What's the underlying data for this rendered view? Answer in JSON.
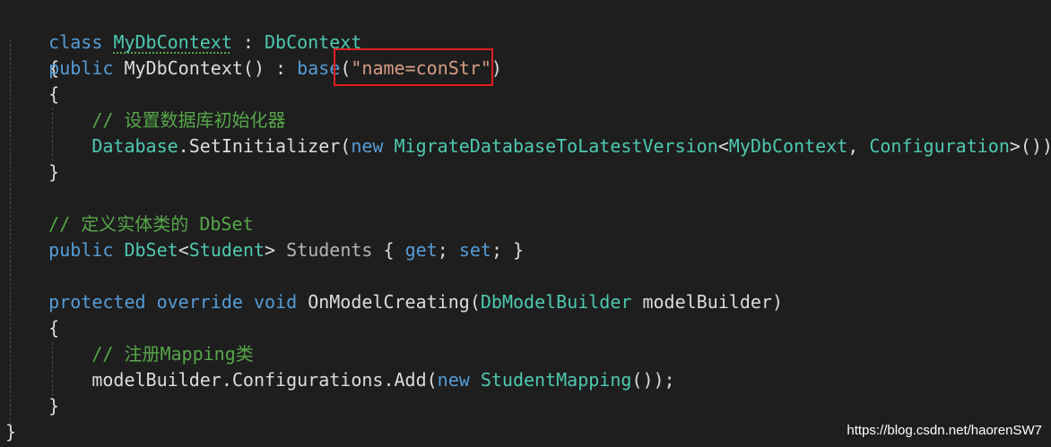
{
  "code": {
    "l1": {
      "kw": "class",
      "name": "MyDbContext",
      "sep": " : ",
      "base": "DbContext"
    },
    "l2": {
      "brace": "{"
    },
    "l3": {
      "kw": "public",
      "name": "MyDbContext",
      "paren": "() : ",
      "base_kw": "base",
      "open": "(",
      "string": "\"name=conStr\"",
      "close": ")"
    },
    "l4": {
      "brace": "{"
    },
    "l5": {
      "comment": "// 设置数据库初始化器"
    },
    "l6": {
      "obj": "Database",
      "dot": ".",
      "method": "SetInitializer",
      "open": "(",
      "new_kw": "new",
      "type1": "MigrateDatabaseToLatestVersion",
      "lt": "<",
      "type2": "MyDbContext",
      "comma": ", ",
      "type3": "Configuration",
      "end": ">());"
    },
    "l7": {
      "brace": "}"
    },
    "l9": {
      "comment": "// 定义实体类的 DbSet"
    },
    "l10": {
      "kw": "public",
      "type1": "DbSet",
      "lt": "<",
      "type2": "Student",
      "gt": ">",
      "name": " Students ",
      "ob": "{ ",
      "get": "get",
      "semi1": "; ",
      "set": "set",
      "semi2": "; }"
    },
    "l12": {
      "kw1": "protected",
      "kw2": "override",
      "kw3": "void",
      "method": "OnModelCreating",
      "open": "(",
      "type": "DbModelBuilder",
      "param": " modelBuilder)"
    },
    "l13": {
      "brace": "{"
    },
    "l14": {
      "comment": "// 注册Mapping类"
    },
    "l15": {
      "obj": "modelBuilder",
      "dot1": ".",
      "prop": "Configurations",
      "dot2": ".",
      "method": "Add",
      "open": "(",
      "new_kw": "new",
      "type": "StudentMapping",
      "end": "());"
    },
    "l16": {
      "brace": "}"
    },
    "l17": {
      "brace": "}"
    }
  },
  "watermark": "https://blog.csdn.net/haorenSW7",
  "colors": {
    "background": "#1e1e1e",
    "keyword": "#569cd6",
    "type": "#4ec9b0",
    "string": "#d69d85",
    "comment": "#57a64a",
    "highlight": "#e02020"
  }
}
